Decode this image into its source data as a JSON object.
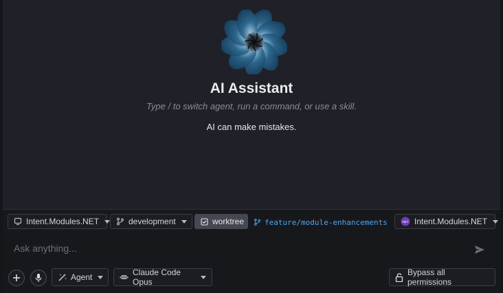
{
  "header": {
    "title": "AI Assistant",
    "subtitle": "Type / to switch agent, run a command, or use a skill.",
    "disclaimer": "AI can make mistakes."
  },
  "logo": {
    "icon": "spiral-flower-logo",
    "colors": [
      "#1b4f74",
      "#2a6690",
      "#7fb0cc"
    ]
  },
  "context_bar": {
    "project": {
      "label": "Intent.Modules.NET",
      "icon": "monitor-icon"
    },
    "branch": {
      "label": "development",
      "icon": "git-branch-icon"
    },
    "worktree": {
      "label": "worktree",
      "icon": "checkbox-icon"
    },
    "feature_branch": {
      "label": "feature/module-enhancements",
      "icon": "git-branch-icon",
      "color": "#4ea6f0"
    },
    "solution": {
      "label": "Intent.Modules.NET",
      "badge": "NET",
      "badge_color": "#6a3fb8"
    }
  },
  "composer": {
    "placeholder": "Ask anything...",
    "send_icon": "send-icon"
  },
  "toolbar": {
    "add_icon": "plus-icon",
    "mic_icon": "microphone-icon",
    "agent": {
      "label": "Agent",
      "icon": "magic-wand-icon"
    },
    "model": {
      "label": "Claude Code Opus",
      "icon": "robot-icon"
    },
    "permissions": {
      "label": "Bypass all permissions",
      "icon": "unlock-icon"
    }
  }
}
